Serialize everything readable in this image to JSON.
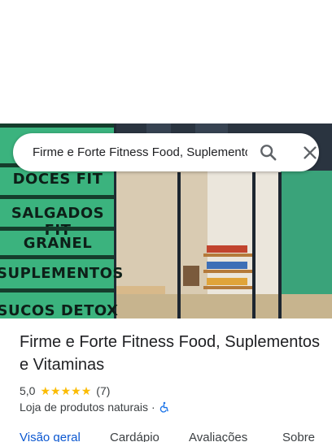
{
  "search": {
    "query": "Firme e Forte Fitness Food, Suplementos e Vitaminas"
  },
  "hero": {
    "banner_words": [
      "DOCES FIT",
      "SALGADOS FIT",
      "GRANEL",
      "SUPLEMENTOS",
      "SUCOS DETOX"
    ]
  },
  "place": {
    "title": "Firme e Forte Fitness Food, Suplementos e Vitaminas",
    "rating": "5,0",
    "stars": 5,
    "review_count": "(7)",
    "category": "Loja de produtos naturais",
    "separator": "·"
  },
  "tabs": [
    {
      "label": "Visão geral",
      "active": true
    },
    {
      "label": "Cardápio",
      "active": false
    },
    {
      "label": "Avaliações",
      "active": false
    },
    {
      "label": "Sobre",
      "active": false
    }
  ],
  "colors": {
    "accent": "#0b57d0",
    "star": "#fbbc04",
    "accessible_icon": "#1a73e8"
  },
  "icons": {
    "search": "search-icon",
    "close": "close-icon",
    "accessibility": "wheelchair-icon"
  }
}
